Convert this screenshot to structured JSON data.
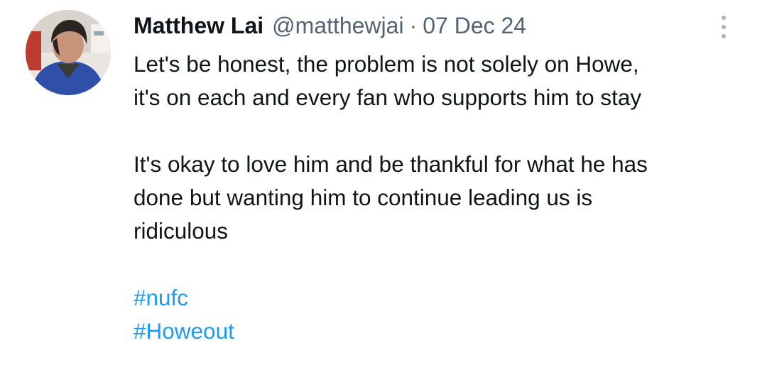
{
  "author": {
    "display_name": "Matthew Lai",
    "handle": "@matthewjai",
    "separator": "·",
    "date": "07 Dec 24"
  },
  "icons": {
    "avatar": "profile-photo",
    "more": "more-vertical-icon"
  },
  "tweet": {
    "paragraph1": [
      "Let's be honest, the problem is not solely on Howe,",
      "it's on each and every fan who supports him to stay"
    ],
    "paragraph2": [
      "It's okay to love him and be thankful for what he has",
      "done but wanting him to continue leading us is",
      "ridiculous"
    ],
    "hashtags": [
      "#nufc",
      "#Howeout"
    ]
  },
  "colors": {
    "text": "#0f1419",
    "secondary": "#536471",
    "link": "#1d9bf0",
    "more_icon": "#a7b3bd"
  }
}
